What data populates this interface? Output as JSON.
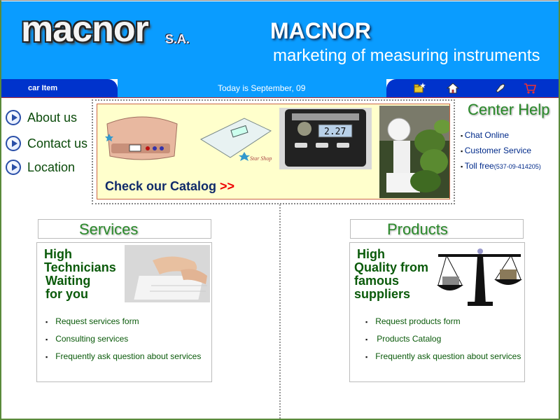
{
  "header": {
    "logo_text": "macnor",
    "logo_suffix": "S.A.",
    "title": "MACNOR",
    "subtitle": "marketing of measuring instruments"
  },
  "navbar": {
    "left_label": "car Item",
    "date_text": "Today is September, 09",
    "icons": [
      "folder-star-icon",
      "home-icon",
      "phone-icon",
      "shopping-cart-icon"
    ]
  },
  "sidebar": {
    "links": [
      {
        "label": "About us"
      },
      {
        "label": "Contact us"
      },
      {
        "label": "Location"
      }
    ]
  },
  "catalog": {
    "link_text": "Check our Catalog",
    "link_arrows": ">>",
    "scale_display": "2.27",
    "badge_text": "Star Shop"
  },
  "center_help": {
    "title": "Center Help",
    "items": [
      {
        "label": "Chat Online"
      },
      {
        "label": "Customer Service"
      },
      {
        "label": "Toll free",
        "extra": "(537-09-414205)"
      }
    ]
  },
  "services": {
    "title": "Services",
    "headline": [
      "High",
      "Technicians",
      "Waiting",
      "for you"
    ],
    "links": [
      {
        "label": "Request services form"
      },
      {
        "label": "Consulting services"
      },
      {
        "label": "Frequently ask question about services"
      }
    ]
  },
  "products": {
    "title": "Products",
    "headline": [
      "High",
      "Quality from",
      "famous",
      "suppliers"
    ],
    "links": [
      {
        "label": "Request products  form"
      },
      {
        "label": "Products Catalog"
      },
      {
        "label": "Frequently ask question about services"
      }
    ]
  },
  "colors": {
    "header_blue": "#0a9cff",
    "nav_dark_blue": "#0033cc",
    "green_text": "#0a5a0a",
    "title_green": "#2a8a2a",
    "catalog_bg": "#ffffcc"
  }
}
